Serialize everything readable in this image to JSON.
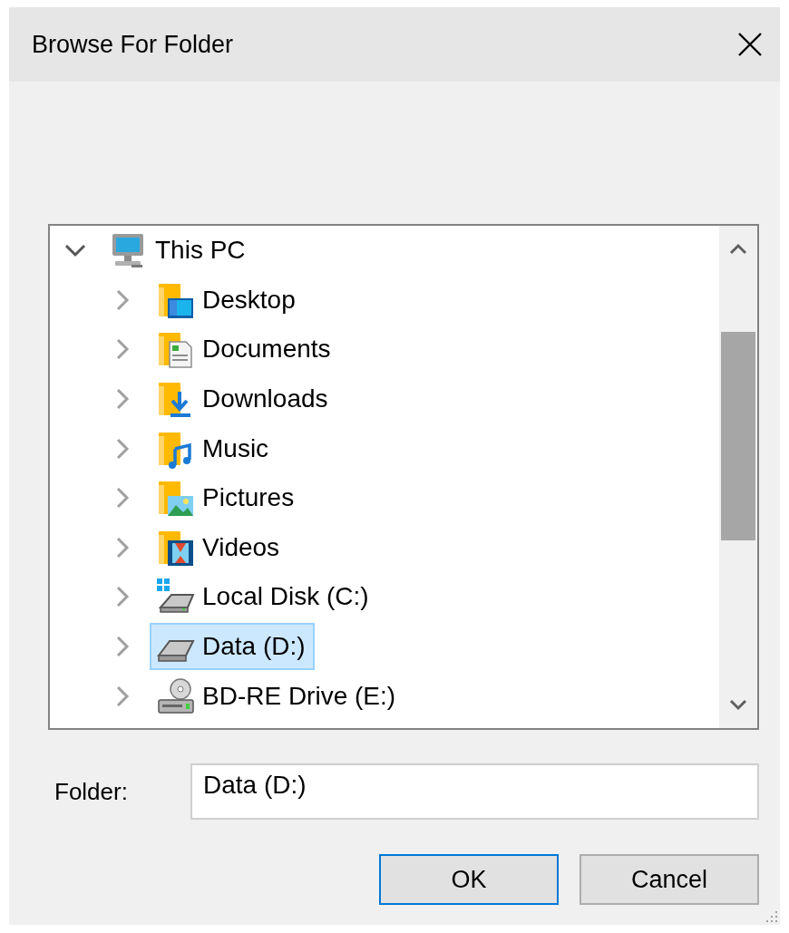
{
  "window": {
    "title": "Browse For Folder"
  },
  "tree": {
    "label": "This PC",
    "kind": "computer",
    "expanded": true,
    "selected": false,
    "children": [
      {
        "label": "Desktop",
        "kind": "desktop",
        "expanded": false,
        "selected": false
      },
      {
        "label": "Documents",
        "kind": "documents",
        "expanded": false,
        "selected": false
      },
      {
        "label": "Downloads",
        "kind": "downloads",
        "expanded": false,
        "selected": false
      },
      {
        "label": "Music",
        "kind": "music",
        "expanded": false,
        "selected": false
      },
      {
        "label": "Pictures",
        "kind": "pictures",
        "expanded": false,
        "selected": false
      },
      {
        "label": "Videos",
        "kind": "videos",
        "expanded": false,
        "selected": false
      },
      {
        "label": "Local Disk (C:)",
        "kind": "system",
        "expanded": false,
        "selected": false
      },
      {
        "label": "Data (D:)",
        "kind": "drive",
        "expanded": false,
        "selected": true
      },
      {
        "label": "BD-RE Drive (E:)",
        "kind": "optical",
        "expanded": false,
        "selected": false
      }
    ]
  },
  "folder": {
    "label": "Folder:",
    "value": "Data (D:)"
  },
  "buttons": [
    {
      "label": "OK",
      "default": true
    },
    {
      "label": "Cancel",
      "default": false
    }
  ]
}
